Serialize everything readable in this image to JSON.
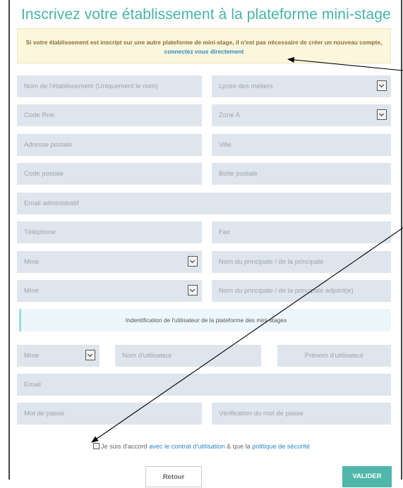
{
  "title": "Inscrivez votre établissement à la plateforme mini-stage",
  "notice": {
    "text": "Si votre établissement est inscript sur une autre plateforme de mini-stage, il n'est pas nécessaire de créer un nouveau compte, ",
    "link": "connectez vous directement"
  },
  "fields": {
    "etablissement": "Nom de l'établissement (Uniquement le nom)",
    "type_etablissement": "Lycée des métiers",
    "code_rne": "Code Rne",
    "zone": "Zone A",
    "adresse": "Adresse postale",
    "ville": "Ville",
    "code_postal": "Code postale",
    "boite_postale": "Boite postale",
    "email_admin": "Email administratif",
    "telephone": "Téléphone",
    "fax": "Fax",
    "civilite_principal": "Mme",
    "nom_principal": "Nom du principale / de la principale",
    "civilite_adjoint": "Mme",
    "nom_adjoint": "Nom du principale / de la principale adjoint(e)"
  },
  "user_section": {
    "heading": "Indentification de l'utilisateur de la plateforme des mini-stages",
    "civilite": "Mme",
    "nom": "Nom d'utilisateur",
    "prenom": "Prénom d'utilisateur",
    "email": "Email",
    "password": "Mot de passe",
    "password_confirm": "Vérification du mot de passe"
  },
  "agreement": {
    "prefix": "Je suis d'accord ",
    "link1": "avec le contrat d'utilisation",
    "middle": " & que la ",
    "link2": "politique de sécurité"
  },
  "buttons": {
    "back": "Retour",
    "submit": "VALIDER"
  },
  "colors": {
    "accent": "#46b4a6",
    "field_bg": "#dfe5ec",
    "link": "#2f87c2"
  }
}
